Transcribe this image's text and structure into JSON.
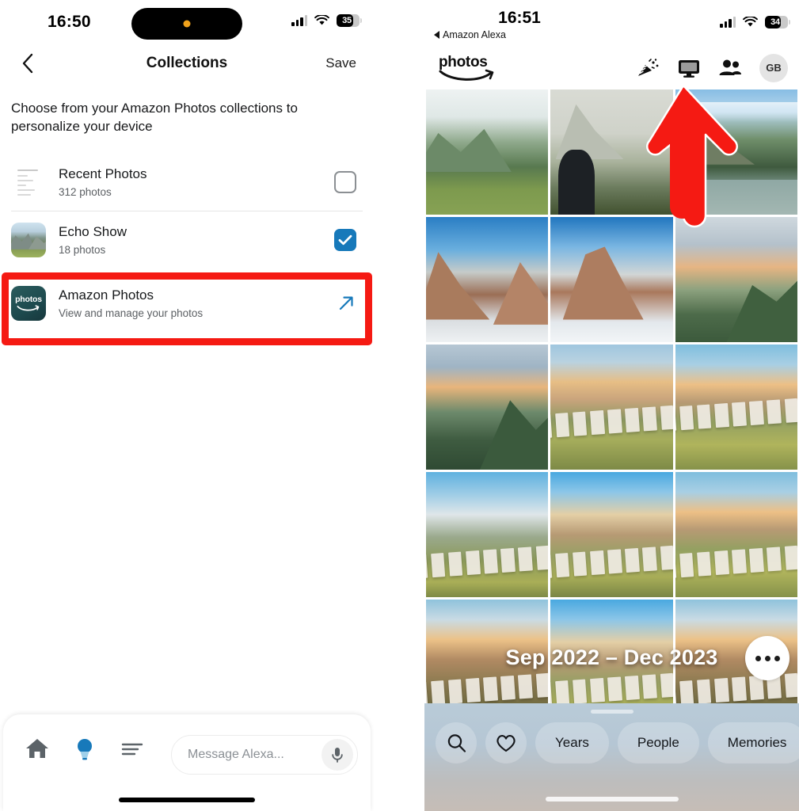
{
  "left_panel": {
    "status_bar": {
      "time": "16:50",
      "battery_percent": "35",
      "wifi_icon": "wifi-icon",
      "cellular_icon": "cellular-signal-icon"
    },
    "nav": {
      "back_icon": "chevron-left-icon",
      "title": "Collections",
      "save_label": "Save"
    },
    "intro_text": "Choose from your Amazon Photos collections to personalize your device",
    "collections": [
      {
        "title": "Recent Photos",
        "subtitle": "312 photos",
        "thumb": "document-lines-thumbnail",
        "control": "checkbox",
        "checked": false
      },
      {
        "title": "Echo Show",
        "subtitle": "18 photos",
        "thumb": "mountain-photo-thumbnail",
        "control": "checkbox",
        "checked": true
      },
      {
        "title": "Amazon Photos",
        "subtitle": "View and manage your photos",
        "thumb": "amazon-photos-app-icon",
        "control": "external-link",
        "icon_word": "photos"
      }
    ],
    "highlight_color": "#f51a13",
    "bottom_bar": {
      "home_icon": "home-icon",
      "devices_icon": "lightbulb-icon",
      "more_icon": "list-lines-icon",
      "input_placeholder": "Message Alexa...",
      "mic_icon": "microphone-icon"
    }
  },
  "right_panel": {
    "status_bar": {
      "time": "16:51",
      "back_app_label": "Amazon Alexa",
      "battery_percent": "34",
      "wifi_icon": "wifi-icon",
      "cellular_icon": "cellular-signal-icon"
    },
    "header": {
      "logo_word": "photos",
      "logo_smile": "amazon-smile-icon",
      "actions": [
        {
          "name": "confetti-icon",
          "label": "Celebrate"
        },
        {
          "name": "display-icon",
          "label": "Cast to display"
        },
        {
          "name": "people-icon",
          "label": "Family vault"
        }
      ],
      "avatar_initials": "GB"
    },
    "grid": {
      "columns": 3,
      "photos": [
        "alpine-meadow-valley",
        "person-looking-at-misty-mountain",
        "mountain-lake-with-ducks",
        "snowy-red-rock-canyon",
        "snow-capped-peaks",
        "coastal-hills-at-dusk",
        "green-hillside-sunset",
        "hollywood-sign-from-behind-1",
        "hollywood-sign-from-behind-2",
        "hollywood-sign-from-behind-3",
        "hollywood-sign-over-city",
        "hollywood-sign-from-behind-4",
        "hollywood-sign-sunrise-1",
        "hollywood-sign-sunrise-2",
        "hollywood-sign-sunrise-3"
      ]
    },
    "date_overlay": "Sep 2022 – Dec 2023",
    "more_button": "more-options-icon",
    "bottom_sheet": {
      "search_icon": "search-icon",
      "favorites_icon": "heart-icon",
      "pills": [
        "Years",
        "People",
        "Memories"
      ]
    },
    "arrow_annotation_color": "#f51a13"
  }
}
